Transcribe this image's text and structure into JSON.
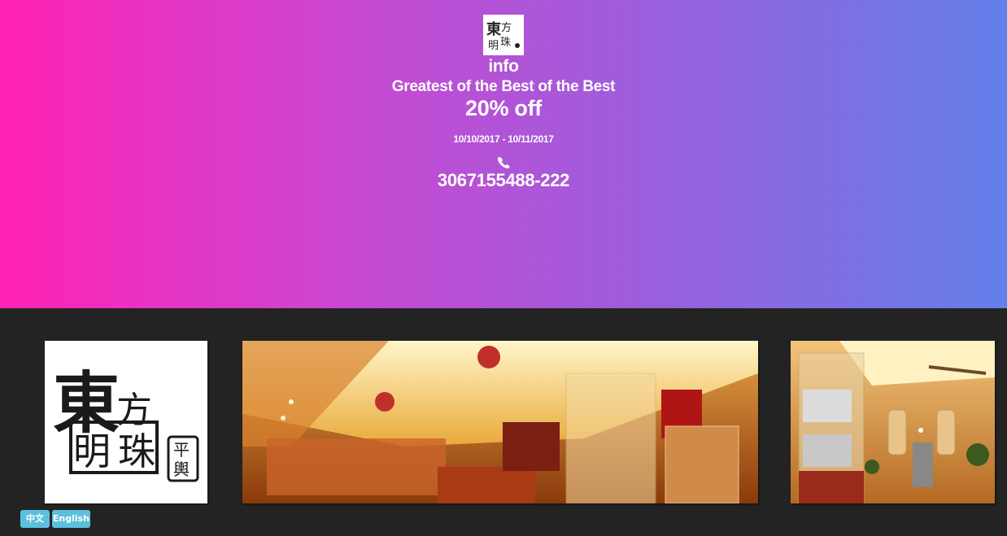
{
  "hero": {
    "title": "info",
    "subtitle": "Greatest of the Best of the Best",
    "offer": "20% off",
    "dates": "10/10/2017 - 10/11/2017",
    "phone_icon": "phone-icon",
    "phone": "3067155488-222"
  },
  "logo": {
    "glyphs": [
      "東",
      "方",
      "明",
      "珠",
      "平",
      "輿"
    ]
  },
  "gallery": {
    "images": [
      "restaurant-logo",
      "restaurant-interior-wide",
      "restaurant-interior-side"
    ]
  },
  "language": {
    "chinese_label": "中文",
    "english_label": "English"
  },
  "colors": {
    "gradient_start": "#ff22b4",
    "gradient_end": "#6380ea",
    "strip_bg": "#232323",
    "lang_button": "#5bc0de"
  }
}
